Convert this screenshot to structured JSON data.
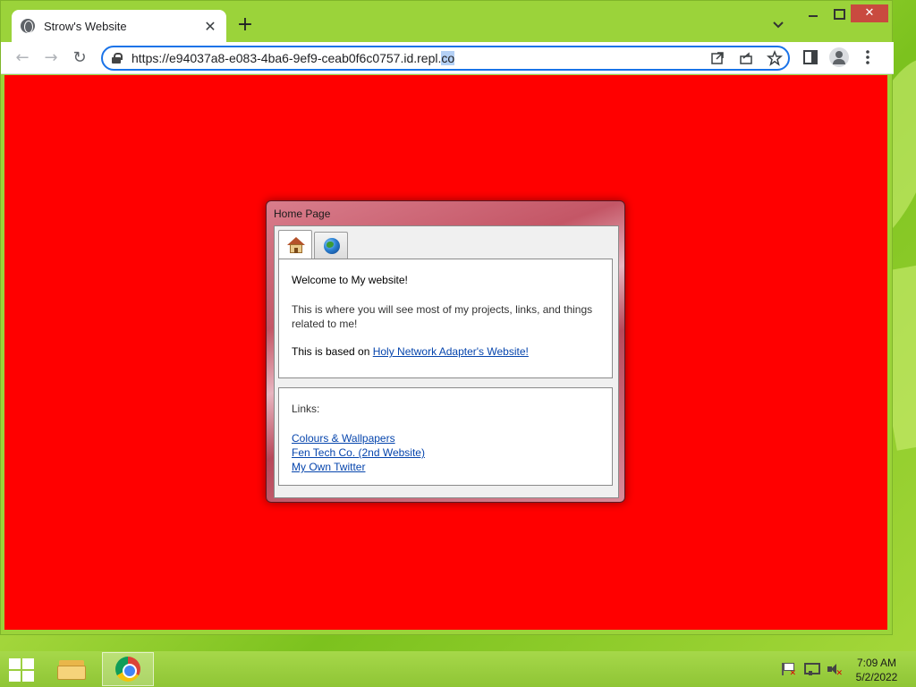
{
  "browser": {
    "tab_title": "Strow's Website",
    "tab_close": "✕",
    "new_tab": "+",
    "url_main": "https://e94037a8-e083-4ba6-9ef9-ceab0f6c0757.id.repl.",
    "url_selected": "co",
    "nav": {
      "back": "←",
      "forward": "→",
      "reload": "↻"
    },
    "window_close": "✕"
  },
  "page": {
    "background_color": "#ff0000",
    "window_title": "Home Page",
    "tabs": [
      {
        "icon": "home-icon"
      },
      {
        "icon": "globe-icon"
      }
    ],
    "welcome": "Welcome to My website!",
    "description": "This is where you will see most of my projects, links, and things related to me!",
    "based_on_prefix": "This is based on ",
    "based_on_link": "Holy Network Adapter's Website!",
    "links_label": "Links:",
    "links": [
      "Colours & Wallpapers",
      "Fen Tech Co. (2nd Website)",
      "My Own Twitter"
    ]
  },
  "taskbar": {
    "time": "7:09 AM",
    "date": "5/2/2022"
  }
}
